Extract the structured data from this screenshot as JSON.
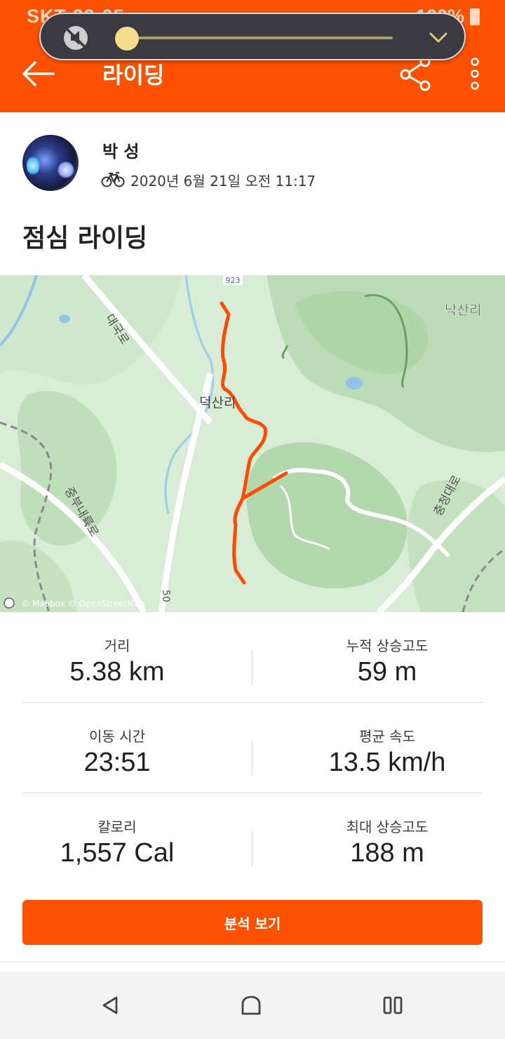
{
  "status_bar": {
    "carrier_time": "SKT 22:05",
    "battery": "100%"
  },
  "app_bar": {
    "title": "라이딩",
    "back_icon": "arrow-left-icon",
    "share_icon": "share-icon",
    "more_icon": "more-vertical-icon"
  },
  "volume_overlay": {
    "mute_icon": "sound-off-icon",
    "level": 0.03,
    "expand_icon": "chevron-down-icon"
  },
  "athlete": {
    "name": "박 성",
    "sport_icon": "bicycle-icon",
    "datetime": "2020년 6월 21일 오전 11:17"
  },
  "activity": {
    "title": "점심 라이딩"
  },
  "map": {
    "road_number": "923",
    "place_north": "낙산리",
    "place_center": "덕산리",
    "road_upper_left": "대국로",
    "road_lower_left": "중부내륙로",
    "road_right": "충청대로",
    "road_bottom": "50",
    "attribution": "© Mapbox © OpenStreetMap",
    "route_color": "#fc4c02"
  },
  "stats": [
    {
      "label": "거리",
      "value": "5.38 km"
    },
    {
      "label": "누적 상승고도",
      "value": "59 m"
    },
    {
      "label": "이동 시간",
      "value": "23:51"
    },
    {
      "label": "평균 속도",
      "value": "13.5 km/h"
    },
    {
      "label": "칼로리",
      "value": "1,557 Cal"
    },
    {
      "label": "최대 상승고도",
      "value": "188 m"
    }
  ],
  "buttons": {
    "analysis": "분석 보기"
  },
  "nav": {
    "back_icon": "nav-back-icon",
    "home_icon": "nav-home-icon",
    "recents_icon": "nav-recents-icon"
  },
  "colors": {
    "brand": "#fc5200",
    "map_green": "#d8ecd6",
    "map_green_dark": "#b9dbb4"
  }
}
